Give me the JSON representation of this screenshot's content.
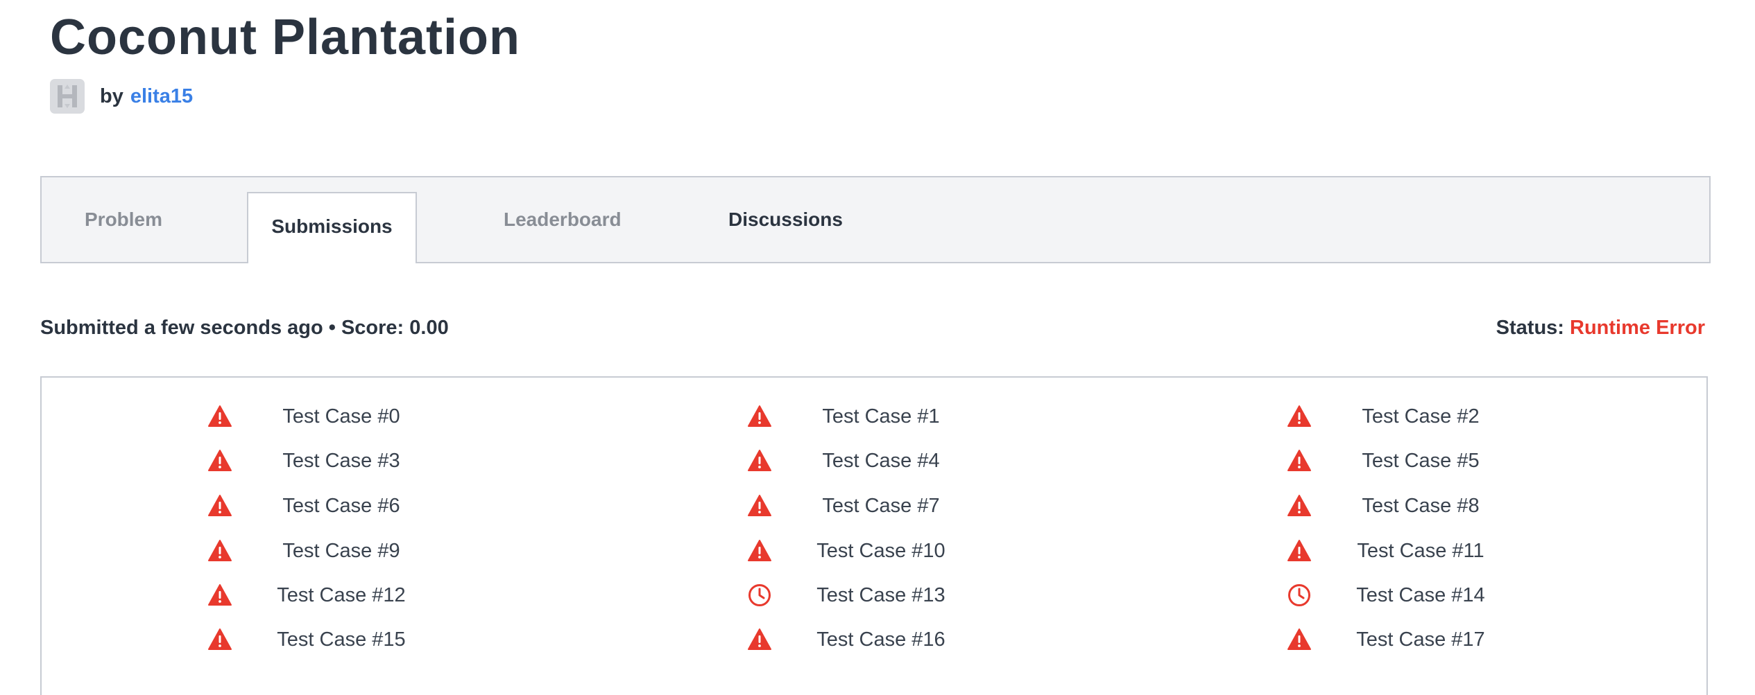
{
  "challenge": {
    "title": "Coconut Plantation",
    "by_label": "by",
    "author": "elita15",
    "avatar_icon": "hackerrank-logo-icon"
  },
  "tabs": [
    {
      "label": "Problem",
      "active": false
    },
    {
      "label": "Submissions",
      "active": true
    },
    {
      "label": "Leaderboard",
      "active": false
    },
    {
      "label": "Discussions",
      "active": false
    }
  ],
  "submission": {
    "summary": "Submitted a few seconds ago • Score: 0.00",
    "status_label": "Status:",
    "status_value": "Runtime Error",
    "status_color": "#e8392d"
  },
  "test_cases": [
    {
      "label": "Test Case #0",
      "icon": "warning-icon"
    },
    {
      "label": "Test Case #1",
      "icon": "warning-icon"
    },
    {
      "label": "Test Case #2",
      "icon": "warning-icon"
    },
    {
      "label": "Test Case #3",
      "icon": "warning-icon"
    },
    {
      "label": "Test Case #4",
      "icon": "warning-icon"
    },
    {
      "label": "Test Case #5",
      "icon": "warning-icon"
    },
    {
      "label": "Test Case #6",
      "icon": "warning-icon"
    },
    {
      "label": "Test Case #7",
      "icon": "warning-icon"
    },
    {
      "label": "Test Case #8",
      "icon": "warning-icon"
    },
    {
      "label": "Test Case #9",
      "icon": "warning-icon"
    },
    {
      "label": "Test Case #10",
      "icon": "warning-icon"
    },
    {
      "label": "Test Case #11",
      "icon": "warning-icon"
    },
    {
      "label": "Test Case #12",
      "icon": "warning-icon"
    },
    {
      "label": "Test Case #13",
      "icon": "clock-icon"
    },
    {
      "label": "Test Case #14",
      "icon": "clock-icon"
    },
    {
      "label": "Test Case #15",
      "icon": "warning-icon"
    },
    {
      "label": "Test Case #16",
      "icon": "warning-icon"
    },
    {
      "label": "Test Case #17",
      "icon": "warning-icon"
    }
  ]
}
